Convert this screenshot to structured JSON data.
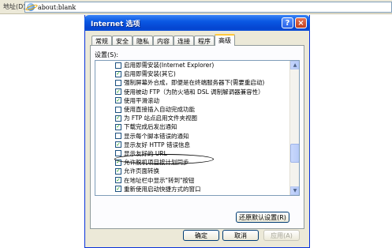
{
  "browser": {
    "address_label": "地址(D)",
    "address_value": "about:blank"
  },
  "dialog": {
    "title": "Internet 选项",
    "help_glyph": "?",
    "close_glyph": "×",
    "tabs": [
      "常规",
      "安全",
      "隐私",
      "内容",
      "连接",
      "程序",
      "高级"
    ],
    "active_tab": "高级",
    "settings_label": "设置(S):",
    "settings": [
      {
        "label": "启用即需安装(Internet Explorer)",
        "checked": false
      },
      {
        "label": "启用即需安装(其它)",
        "checked": true
      },
      {
        "label": "强制屏幕外合成，即便是在终端服务器下(需要重启动)",
        "checked": false
      },
      {
        "label": "使用被动 FTP（为防火墙和 DSL 调制解调器兼容性）",
        "checked": true
      },
      {
        "label": "使用平滑滚动",
        "checked": true
      },
      {
        "label": "使用直接插入自动完成功能",
        "checked": false
      },
      {
        "label": "为 FTP 站点启用文件夹视图",
        "checked": true
      },
      {
        "label": "下载完成后发出通知",
        "checked": true
      },
      {
        "label": "显示每个脚本错误的通知",
        "checked": false
      },
      {
        "label": "显示友好 HTTP 错误信息",
        "checked": true
      },
      {
        "label": "显示友好的 URL",
        "checked": false
      },
      {
        "label": "允许脱机项目按计划同步",
        "checked": true
      },
      {
        "label": "允许页面转换",
        "checked": true
      },
      {
        "label": "在地址栏中显示\"转到\"按钮",
        "checked": true
      },
      {
        "label": "重新使用启动快捷方式的窗口",
        "checked": true
      }
    ],
    "restore_button": "还原默认设置(R)",
    "ok_button": "确定",
    "cancel_button": "取消",
    "apply_button": "应用(A)"
  }
}
